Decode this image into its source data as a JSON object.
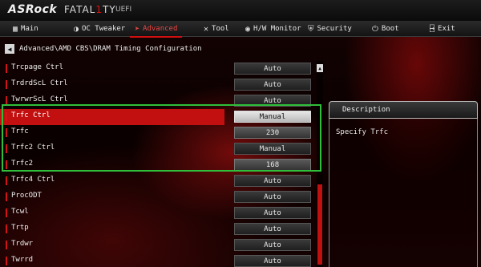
{
  "brand": {
    "name": "ASRock",
    "series_a": "FATAL",
    "series_ty": "1",
    "series_b": "TY",
    "uefi": "UEFI"
  },
  "nav": {
    "tabs": [
      {
        "label": "Main",
        "icon": "main-icon",
        "glyph": "▦"
      },
      {
        "label": "OC Tweaker",
        "icon": "oc-tweaker-icon",
        "glyph": "◑"
      },
      {
        "label": "Advanced",
        "icon": "advanced-icon",
        "glyph": "➤"
      },
      {
        "label": "Tool",
        "icon": "tool-icon",
        "glyph": "✕"
      },
      {
        "label": "H/W Monitor",
        "icon": "hw-monitor-icon",
        "glyph": "◉"
      },
      {
        "label": "Security",
        "icon": "security-icon",
        "glyph": "⛨"
      },
      {
        "label": "Boot",
        "icon": "boot-icon",
        "glyph": "⏻"
      },
      {
        "label": "Exit",
        "icon": "exit-icon",
        "glyph": "⍈"
      }
    ],
    "active": "Advanced"
  },
  "breadcrumb": "Advanced\\AMD CBS\\DRAM Timing Configuration",
  "settings": [
    {
      "label": "Trcpage Ctrl",
      "value": "Auto"
    },
    {
      "label": "TrdrdScL Ctrl",
      "value": "Auto"
    },
    {
      "label": "TwrwrScL Ctrl",
      "value": "Auto"
    },
    {
      "label": "Trfc Ctrl",
      "value": "Manual",
      "selected": true
    },
    {
      "label": "Trfc",
      "value": "230",
      "numeric": true
    },
    {
      "label": "Trfc2 Ctrl",
      "value": "Manual"
    },
    {
      "label": "Trfc2",
      "value": "168",
      "numeric": true
    },
    {
      "label": "Trfc4 Ctrl",
      "value": "Auto"
    },
    {
      "label": "ProcODT",
      "value": "Auto"
    },
    {
      "label": "Tcwl",
      "value": "Auto"
    },
    {
      "label": "Trtp",
      "value": "Auto"
    },
    {
      "label": "Trdwr",
      "value": "Auto"
    },
    {
      "label": "Twrrd",
      "value": "Auto"
    }
  ],
  "description": {
    "title": "Description",
    "text": "Specify Trfc"
  },
  "colors": {
    "accent": "#d01010",
    "highlight_box": "#2fbf3a"
  }
}
